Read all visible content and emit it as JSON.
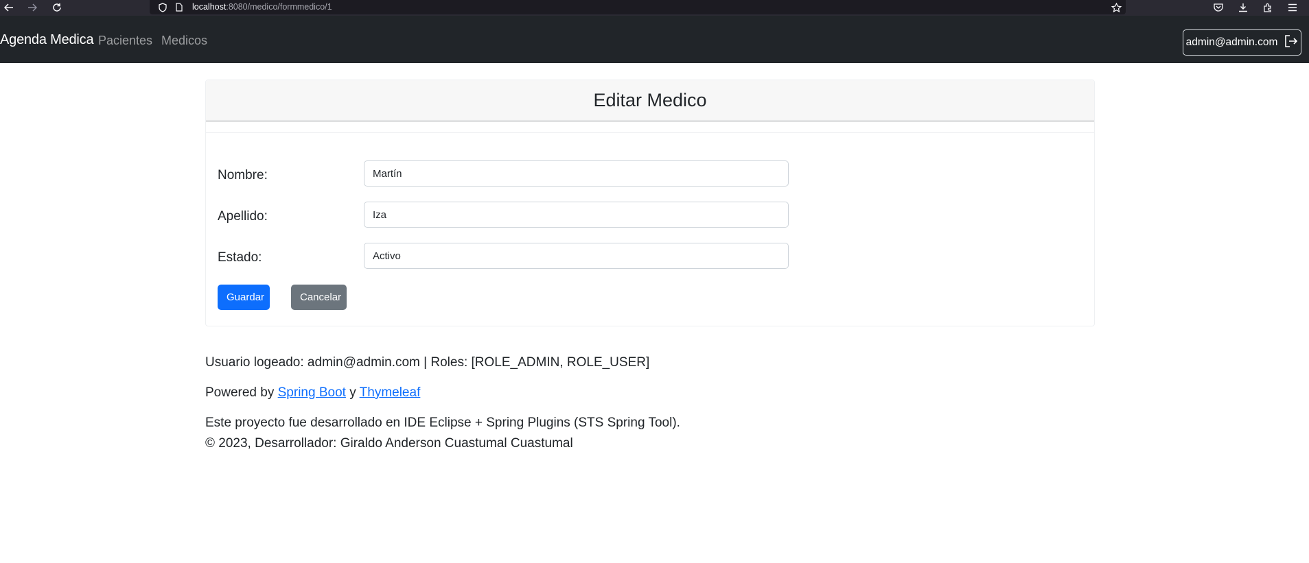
{
  "browser": {
    "url_host": "localhost",
    "url_rest": ":8080/medico/formmedico/1"
  },
  "navbar": {
    "brand": "Agenda Medica",
    "links": [
      "Pacientes",
      "Medicos"
    ],
    "user": "admin@admin.com"
  },
  "form": {
    "title": "Editar Medico",
    "fields": [
      {
        "label": "Nombre:",
        "value": "Martín"
      },
      {
        "label": "Apellido:",
        "value": "Iza"
      },
      {
        "label": "Estado:",
        "value": "Activo"
      }
    ],
    "save_label": "Guardar",
    "cancel_label": "Cancelar"
  },
  "footer": {
    "user_info": "Usuario logeado: admin@admin.com | Roles: [ROLE_ADMIN, ROLE_USER]",
    "powered_prefix": "Powered by ",
    "link_spring": "Spring Boot",
    "powered_and": " y ",
    "link_thymeleaf": "Thymeleaf",
    "ide_note": "Este proyecto fue desarrollado en IDE Eclipse + Spring Plugins (STS Spring Tool).",
    "copyright": "© 2023, Desarrollador: Giraldo Anderson Cuastumal Cuastumal"
  }
}
